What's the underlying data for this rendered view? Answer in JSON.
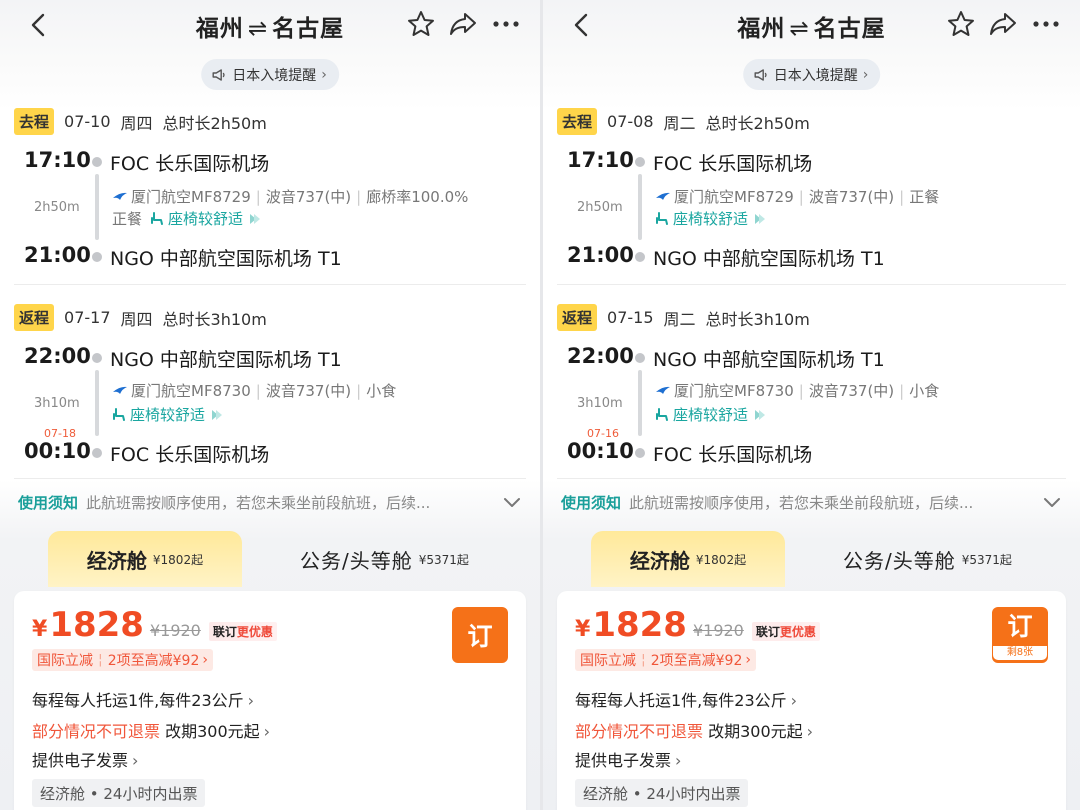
{
  "header": {
    "origin": "福州",
    "arrows": "⇌",
    "destination": "名古屋"
  },
  "notice": {
    "label": "日本入境提醒",
    "chevron": "›"
  },
  "panels": [
    {
      "outbound": {
        "tag": "去程",
        "date": "07-10",
        "weekday": "周四",
        "total": "总时长2h50m",
        "dep_time": "17:10",
        "dep_airport": "FOC 长乐国际机场",
        "duration": "2h50m",
        "flight": "厦门航空MF8729",
        "aircraft": "波音737(中)",
        "extra1": "廊桥率100.0%",
        "meal": "正餐",
        "comfort": "座椅较舒适",
        "arr_time": "21:00",
        "arr_airport": "NGO 中部航空国际机场 T1"
      },
      "inbound": {
        "tag": "返程",
        "date": "07-17",
        "weekday": "周四",
        "total": "总时长3h10m",
        "dep_time": "22:00",
        "dep_airport": "NGO 中部航空国际机场 T1",
        "duration": "3h10m",
        "flight": "厦门航空MF8730",
        "aircraft": "波音737(中)",
        "meal": "小食",
        "comfort": "座椅较舒适",
        "next_day": "07-18",
        "arr_time": "00:10",
        "arr_airport": "FOC 长乐国际机场"
      },
      "usage": {
        "title": "使用须知",
        "text": "此航班需按顺序使用，若您未乘坐前段航班，后续..."
      },
      "tabs": {
        "eco_name": "经济舱",
        "eco_price": "¥1802起",
        "bus_name": "公务/头等舱",
        "bus_price": "¥5371起"
      },
      "fare": {
        "yen": "¥",
        "price": "1828",
        "old_price": "¥1920",
        "promo_a": "联订",
        "promo_b": "更优惠",
        "discount_a": "国际立减",
        "discount_b": "2项至高减¥92",
        "book": "订",
        "remaining": "",
        "baggage": "每程每人托运1件,每件23公斤",
        "refund_warn": "部分情况不可退票",
        "refund_rest": "改期300元起",
        "invoice": "提供电子发票",
        "cabin_tag": "经济舱 • 24小时内出票"
      }
    },
    {
      "outbound": {
        "tag": "去程",
        "date": "07-08",
        "weekday": "周二",
        "total": "总时长2h50m",
        "dep_time": "17:10",
        "dep_airport": "FOC 长乐国际机场",
        "duration": "2h50m",
        "flight": "厦门航空MF8729",
        "aircraft": "波音737(中)",
        "extra1": "正餐",
        "meal": "",
        "comfort": "座椅较舒适",
        "arr_time": "21:00",
        "arr_airport": "NGO 中部航空国际机场 T1"
      },
      "inbound": {
        "tag": "返程",
        "date": "07-15",
        "weekday": "周二",
        "total": "总时长3h10m",
        "dep_time": "22:00",
        "dep_airport": "NGO 中部航空国际机场 T1",
        "duration": "3h10m",
        "flight": "厦门航空MF8730",
        "aircraft": "波音737(中)",
        "meal": "小食",
        "comfort": "座椅较舒适",
        "next_day": "07-16",
        "arr_time": "00:10",
        "arr_airport": "FOC 长乐国际机场"
      },
      "usage": {
        "title": "使用须知",
        "text": "此航班需按顺序使用，若您未乘坐前段航班，后续..."
      },
      "tabs": {
        "eco_name": "经济舱",
        "eco_price": "¥1802起",
        "bus_name": "公务/头等舱",
        "bus_price": "¥5371起"
      },
      "fare": {
        "yen": "¥",
        "price": "1828",
        "old_price": "¥1920",
        "promo_a": "联订",
        "promo_b": "更优惠",
        "discount_a": "国际立减",
        "discount_b": "2项至高减¥92",
        "book": "订",
        "remaining": "剩8张",
        "baggage": "每程每人托运1件,每件23公斤",
        "refund_warn": "部分情况不可退票",
        "refund_rest": "改期300元起",
        "invoice": "提供电子发票",
        "cabin_tag": "经济舱 • 24小时内出票"
      }
    }
  ],
  "colors": {
    "accent": "#f57118",
    "price": "#f04c24",
    "teal": "#1aa6a0",
    "tag_yellow": "#ffd54a"
  }
}
